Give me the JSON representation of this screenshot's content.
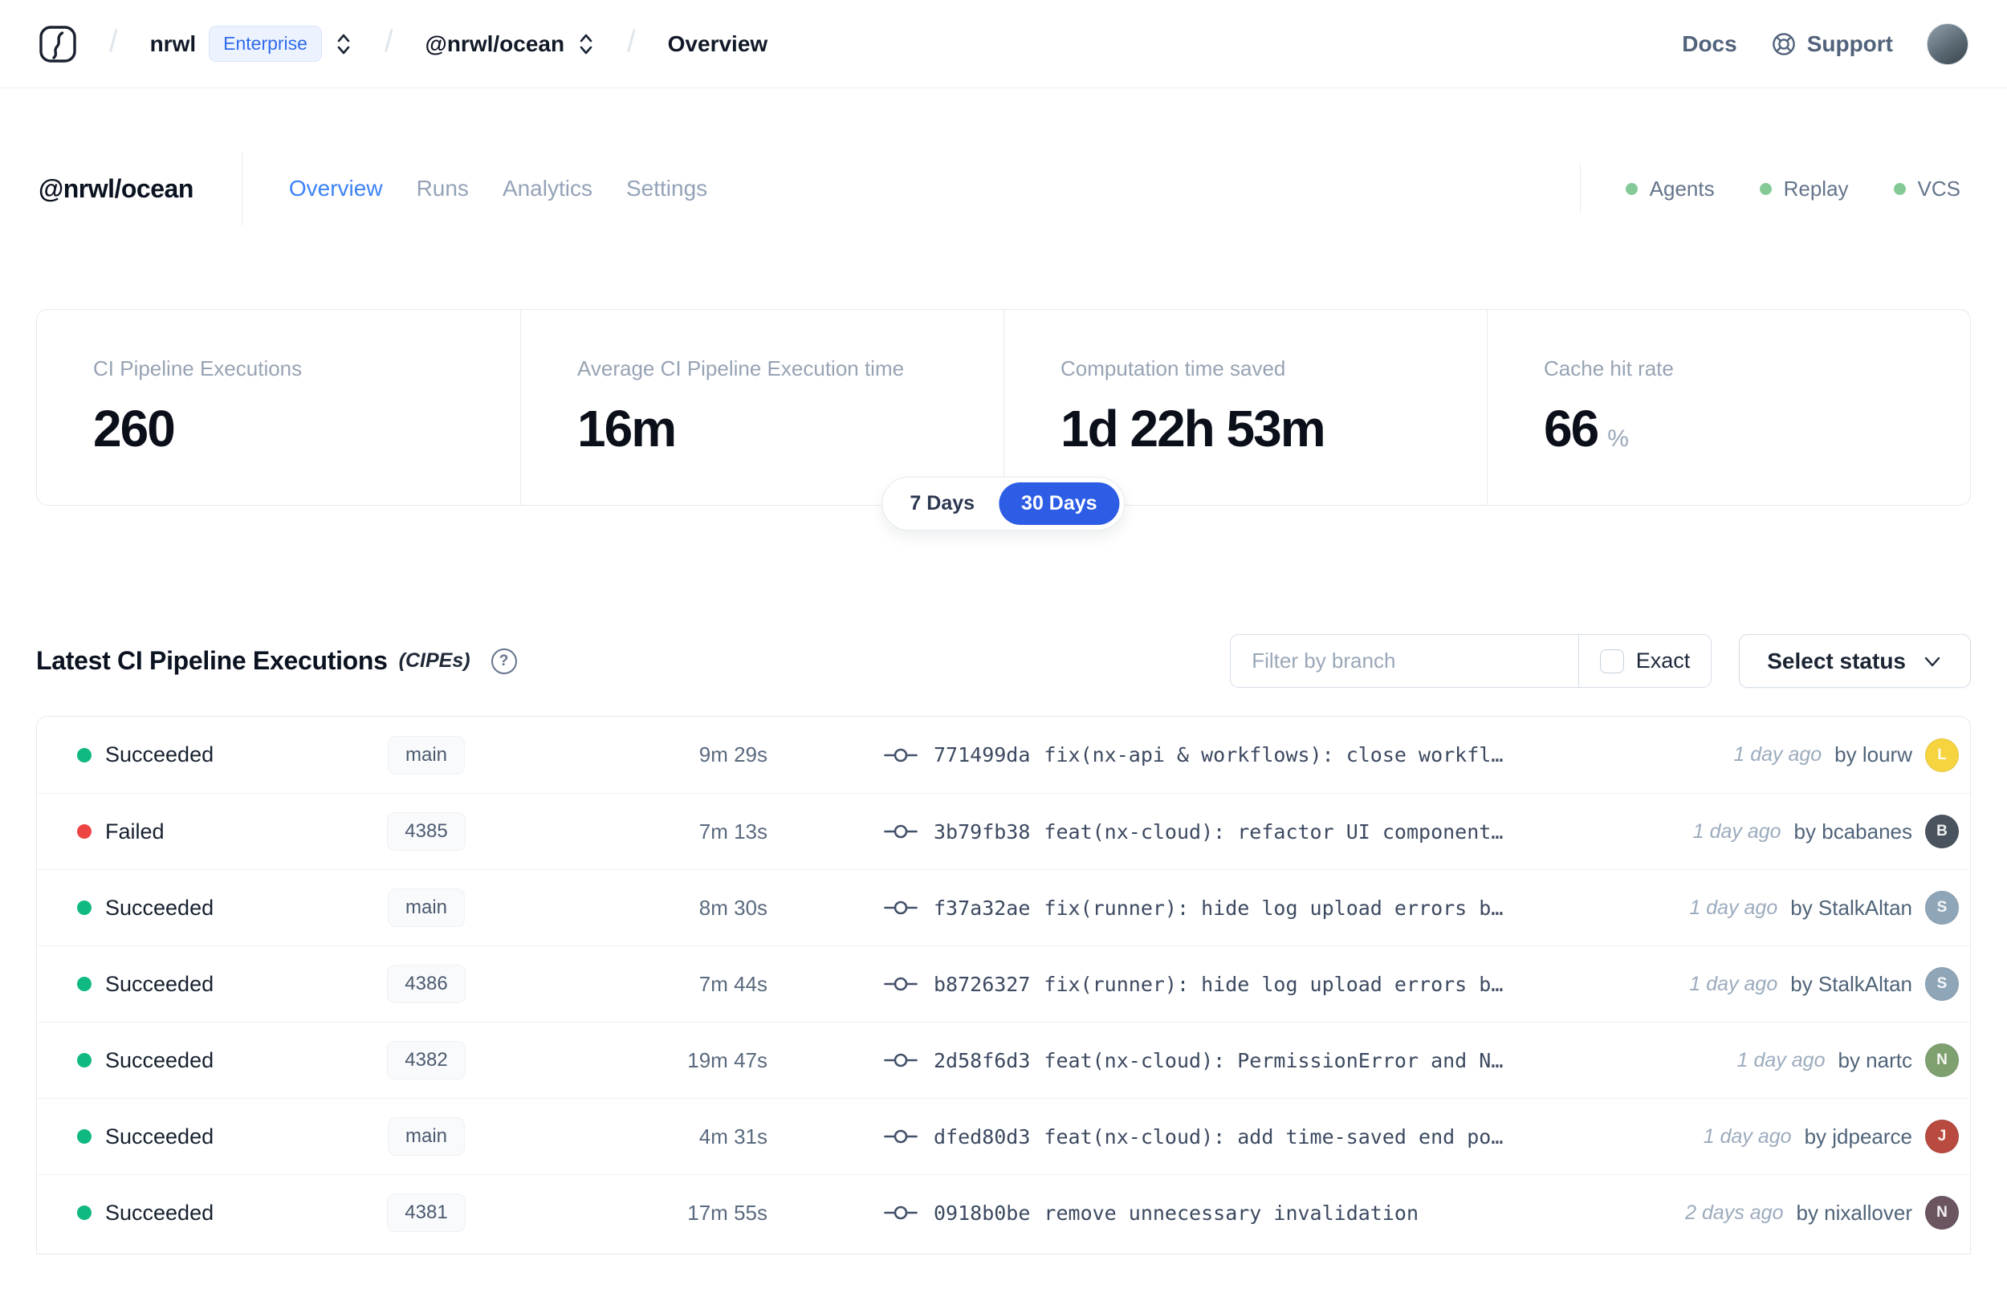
{
  "nav": {
    "separator": "/",
    "org": "nrwl",
    "org_badge": "Enterprise",
    "workspace": "@nrwl/ocean",
    "page": "Overview",
    "docs_label": "Docs",
    "support_label": "Support"
  },
  "header": {
    "title": "@nrwl/ocean",
    "tabs": [
      {
        "label": "Overview",
        "active": true
      },
      {
        "label": "Runs",
        "active": false
      },
      {
        "label": "Analytics",
        "active": false
      },
      {
        "label": "Settings",
        "active": false
      }
    ],
    "statuses": [
      {
        "label": "Agents"
      },
      {
        "label": "Replay"
      },
      {
        "label": "VCS"
      }
    ]
  },
  "stats": {
    "cards": [
      {
        "label": "CI Pipeline Executions",
        "value": "260"
      },
      {
        "label": "Average CI Pipeline Execution time",
        "value": "16m"
      },
      {
        "label": "Computation time saved",
        "value": "1d 22h 53m"
      },
      {
        "label": "Cache hit rate",
        "value": "66",
        "suffix": "%"
      }
    ],
    "range_toggle": {
      "options": [
        "7 Days",
        "30 Days"
      ],
      "selected": "30 Days"
    }
  },
  "executions": {
    "title": "Latest CI Pipeline Executions",
    "title_suffix": "(CIPEs)",
    "help_glyph": "?",
    "filter": {
      "branch_placeholder": "Filter by branch",
      "exact_label": "Exact",
      "status_label": "Select status"
    },
    "by_label": "by",
    "rows": [
      {
        "status": "Succeeded",
        "status_color": "green",
        "branch": "main",
        "duration": "9m 29s",
        "commit_hash": "771499da",
        "commit_message": "fix(nx-api & workflows): close workfl…",
        "time_ago": "1 day ago",
        "author": "lourw",
        "avatar_color": "#f6d440"
      },
      {
        "status": "Failed",
        "status_color": "red",
        "branch": "4385",
        "duration": "7m 13s",
        "commit_hash": "3b79fb38",
        "commit_message": "feat(nx-cloud): refactor UI component…",
        "time_ago": "1 day ago",
        "author": "bcabanes",
        "avatar_color": "#4a545e"
      },
      {
        "status": "Succeeded",
        "status_color": "green",
        "branch": "main",
        "duration": "8m 30s",
        "commit_hash": "f37a32ae",
        "commit_message": "fix(runner): hide log upload errors b…",
        "time_ago": "1 day ago",
        "author": "StalkAltan",
        "avatar_color": "#8fa6b8"
      },
      {
        "status": "Succeeded",
        "status_color": "green",
        "branch": "4386",
        "duration": "7m 44s",
        "commit_hash": "b8726327",
        "commit_message": "fix(runner): hide log upload errors b…",
        "time_ago": "1 day ago",
        "author": "StalkAltan",
        "avatar_color": "#8fa6b8"
      },
      {
        "status": "Succeeded",
        "status_color": "green",
        "branch": "4382",
        "duration": "19m 47s",
        "commit_hash": "2d58f6d3",
        "commit_message": "feat(nx-cloud): PermissionError and N…",
        "time_ago": "1 day ago",
        "author": "nartc",
        "avatar_color": "#7fa06f"
      },
      {
        "status": "Succeeded",
        "status_color": "green",
        "branch": "main",
        "duration": "4m 31s",
        "commit_hash": "dfed80d3",
        "commit_message": "feat(nx-cloud): add time-saved end po…",
        "time_ago": "1 day ago",
        "author": "jdpearce",
        "avatar_color": "#b84a3f"
      },
      {
        "status": "Succeeded",
        "status_color": "green",
        "branch": "4381",
        "duration": "17m 55s",
        "commit_hash": "0918b0be",
        "commit_message": "remove unnecessary invalidation",
        "time_ago": "2 days ago",
        "author": "nixallover",
        "avatar_color": "#6b5560"
      }
    ]
  },
  "colors": {
    "accent_blue": "#2d5ce5",
    "tab_active_blue": "#3c82f6",
    "success_green": "#10b981",
    "failed_red": "#ef4444",
    "header_status_green": "#85ca96"
  }
}
